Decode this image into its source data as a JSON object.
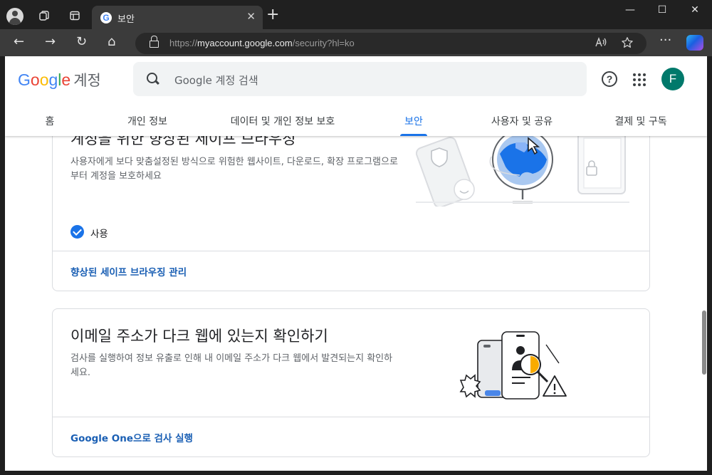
{
  "browser": {
    "tab_title": "보안",
    "favicon_letter": "G",
    "close_tab": "✕",
    "new_tab": "+",
    "url_scheme": "https://",
    "url_host": "myaccount.google.com",
    "url_path": "/security?hl=ko",
    "window_controls": {
      "minimize": "—",
      "maximize": "☐",
      "close": "✕"
    },
    "nav": {
      "back": "←",
      "forward": "→",
      "reload": "↻",
      "home": "⌂",
      "more": "···"
    }
  },
  "header": {
    "logo": {
      "g": "G",
      "o1": "o",
      "o2": "o",
      "g2": "g",
      "l": "l",
      "e": "e"
    },
    "account_label": "계정",
    "search_placeholder": "Google 계정 검색",
    "help": "?",
    "avatar_letter": "F"
  },
  "tabs": [
    {
      "label": "홈"
    },
    {
      "label": "개인 정보"
    },
    {
      "label": "데이터 및 개인 정보 보호"
    },
    {
      "label": "보안",
      "active": true
    },
    {
      "label": "사용자 및 공유"
    },
    {
      "label": "결제 및 구독"
    }
  ],
  "cards": {
    "safe_browsing": {
      "title": "계정을 위한 향상된 세이프 브라우징",
      "description": "사용자에게 보다 맞춤설정된 방식으로 위험한 웹사이트, 다운로드, 확장 프로그램으로부터 계정을 보호하세요",
      "status": "사용",
      "link": "향상된 세이프 브라우징 관리"
    },
    "dark_web": {
      "title": "이메일 주소가 다크 웹에 있는지 확인하기",
      "description": "검사를 실행하여 정보 유출로 인해 내 이메일 주소가 다크 웹에서 발견되는지 확인하세요.",
      "link": "Google One으로 검사 실행"
    }
  },
  "colors": {
    "accent": "#1a73e8",
    "avatar_bg": "#00796b",
    "link": "#1a5fb4"
  }
}
